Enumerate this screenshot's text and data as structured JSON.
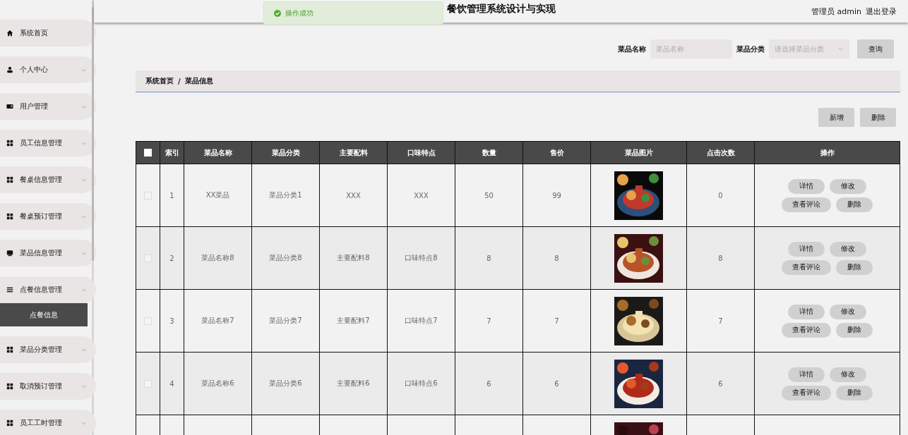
{
  "header": {
    "title": "餐饮管理系统设计与实现",
    "user": "管理员 admin",
    "logout": "退出登录"
  },
  "toast": {
    "message": "操作成功"
  },
  "sidebar": {
    "items": [
      {
        "label": "系统首页"
      },
      {
        "label": "个人中心",
        "expanded": false
      },
      {
        "label": "用户管理",
        "expanded": false
      },
      {
        "label": "员工信息管理",
        "expanded": false
      },
      {
        "label": "餐桌信息管理",
        "expanded": false
      },
      {
        "label": "餐桌预订管理",
        "expanded": false
      },
      {
        "label": "菜品信息管理",
        "expanded": false
      },
      {
        "label": "点餐信息管理",
        "expanded": true,
        "children": [
          {
            "label": "点餐信息",
            "selected": true
          }
        ]
      },
      {
        "label": "菜品分类管理",
        "expanded": false
      },
      {
        "label": "取消预订管理",
        "expanded": false
      },
      {
        "label": "员工工时管理",
        "expanded": false
      }
    ]
  },
  "search": {
    "fields": [
      {
        "kind": "input",
        "label": "菜品名称",
        "placeholder": "菜品名称"
      },
      {
        "kind": "select",
        "label": "菜品分类",
        "placeholder": "请选择菜品分类"
      }
    ],
    "button": "查询"
  },
  "breadcrumb": {
    "items": [
      "系统首页",
      "菜品信息"
    ],
    "separator": "/"
  },
  "actions": [
    "新增",
    "删除"
  ],
  "table": {
    "select_all_checked": false,
    "columns": [
      "索引",
      "菜品名称",
      "菜品分类",
      "主要配料",
      "口味特点",
      "数量",
      "售价",
      "菜品图片",
      "点击次数",
      "操作"
    ],
    "rows": [
      {
        "checked": false,
        "cells": [
          "1",
          "XX菜品",
          "菜品分类1",
          "XXX",
          "XXX",
          "50",
          "99"
        ],
        "image": {
          "kind": "picture"
        },
        "clicks": "0",
        "buttons": [
          "详情",
          "修改",
          "查看评论",
          "删除"
        ]
      },
      {
        "checked": false,
        "cells": [
          "2",
          "菜品名称8",
          "菜品分类8",
          "主要配料8",
          "口味特点8",
          "8",
          "8"
        ],
        "image": {
          "kind": "picture"
        },
        "clicks": "8",
        "buttons": [
          "详情",
          "修改",
          "查看评论",
          "删除"
        ]
      },
      {
        "checked": false,
        "cells": [
          "3",
          "菜品名称7",
          "菜品分类7",
          "主要配料7",
          "口味特点7",
          "7",
          "7"
        ],
        "image": {
          "kind": "picture"
        },
        "clicks": "7",
        "buttons": [
          "详情",
          "修改",
          "查看评论",
          "删除"
        ]
      },
      {
        "checked": false,
        "cells": [
          "4",
          "菜品名称6",
          "菜品分类6",
          "主要配料6",
          "口味特点6",
          "6",
          "6"
        ],
        "image": {
          "kind": "picture"
        },
        "clicks": "6",
        "buttons": [
          "详情",
          "修改",
          "查看评论",
          "删除"
        ]
      },
      {
        "image": {
          "kind": "picture"
        }
      }
    ]
  }
}
